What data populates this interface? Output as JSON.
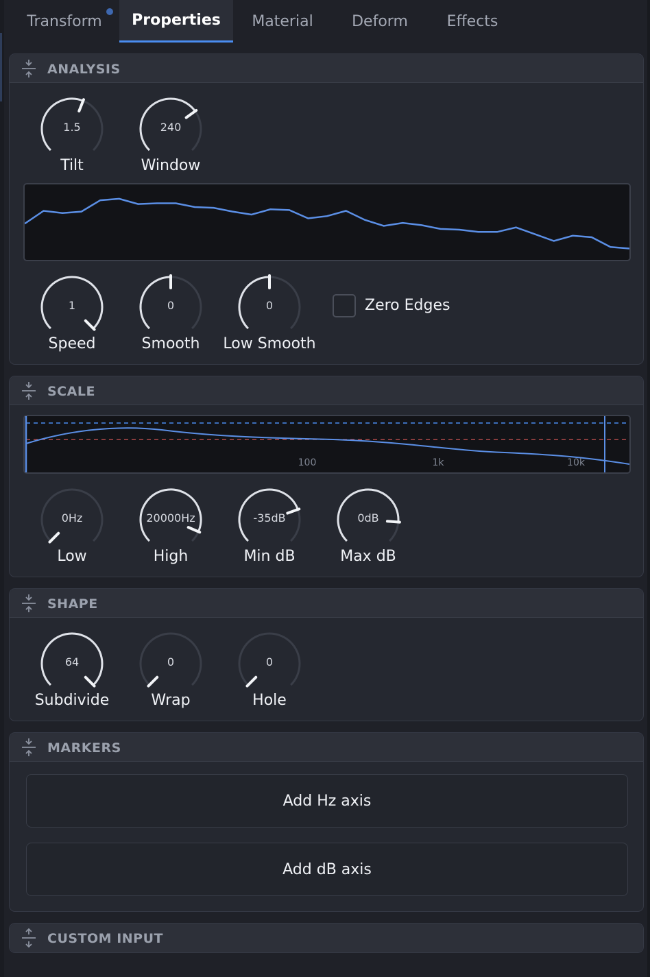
{
  "tabs": [
    {
      "label": "Transform",
      "active": false,
      "has_dot": true
    },
    {
      "label": "Properties",
      "active": true
    },
    {
      "label": "Material",
      "active": false
    },
    {
      "label": "Deform",
      "active": false
    },
    {
      "label": "Effects",
      "active": false
    }
  ],
  "colors": {
    "accent": "#4a8df0",
    "graph_line": "#5b8fe6",
    "reference_red": "#b04a4a"
  },
  "analysis": {
    "title": "ANALYSIS",
    "knobs_top": [
      {
        "label": "Tilt",
        "value": "1.5",
        "fraction": 0.58
      },
      {
        "label": "Window",
        "value": "240",
        "fraction": 0.7
      }
    ],
    "spectrum_points": [
      0.52,
      0.35,
      0.38,
      0.36,
      0.21,
      0.19,
      0.26,
      0.25,
      0.25,
      0.3,
      0.31,
      0.36,
      0.4,
      0.33,
      0.34,
      0.45,
      0.42,
      0.35,
      0.47,
      0.55,
      0.51,
      0.54,
      0.59,
      0.6,
      0.63,
      0.63,
      0.57,
      0.66,
      0.75,
      0.68,
      0.7,
      0.83,
      0.85
    ],
    "knobs_bottom": [
      {
        "label": "Speed",
        "value": "1",
        "fraction": 1.0
      },
      {
        "label": "Smooth",
        "value": "0",
        "fraction": 0.5
      },
      {
        "label": "Low Smooth",
        "value": "0",
        "fraction": 0.5
      }
    ],
    "zero_edges": {
      "label": "Zero Edges",
      "checked": false
    }
  },
  "scale": {
    "title": "SCALE",
    "axis_ticks": [
      "100",
      "1k",
      "10k"
    ],
    "knobs": [
      {
        "label": "Low",
        "value": "0Hz",
        "fraction": 0.0
      },
      {
        "label": "High",
        "value": "20000Hz",
        "fraction": 0.92
      },
      {
        "label": "Min dB",
        "value": "-35dB",
        "fraction": 0.76
      },
      {
        "label": "Max dB",
        "value": "0dB",
        "fraction": 0.85
      }
    ]
  },
  "shape": {
    "title": "SHAPE",
    "knobs": [
      {
        "label": "Subdivide",
        "value": "64",
        "fraction": 1.0
      },
      {
        "label": "Wrap",
        "value": "0",
        "fraction": 0.0
      },
      {
        "label": "Hole",
        "value": "0",
        "fraction": 0.0
      }
    ]
  },
  "markers": {
    "title": "MARKERS",
    "add_hz_label": "Add Hz axis",
    "add_db_label": "Add dB axis"
  },
  "custom_input": {
    "title": "CUSTOM INPUT"
  }
}
